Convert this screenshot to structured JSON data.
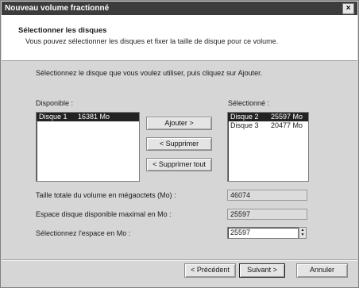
{
  "window": {
    "title": "Nouveau volume fractionné",
    "close_glyph": "×"
  },
  "header": {
    "title": "Sélectionner les disques",
    "subtitle": "Vous pouvez sélectionner les disques et fixer la taille de disque pour ce volume."
  },
  "instruction": "Sélectionnez le disque que vous voulez utiliser, puis cliquez sur Ajouter.",
  "available": {
    "label": "Disponible :",
    "items": [
      {
        "disk": "Disque 1",
        "size": "16381 Mo",
        "selected": true
      }
    ]
  },
  "selected": {
    "label": "Sélectionné :",
    "items": [
      {
        "disk": "Disque 2",
        "size": "25597 Mo",
        "selected": true
      },
      {
        "disk": "Disque 3",
        "size": "20477 Mo",
        "selected": false
      }
    ]
  },
  "buttons": {
    "add": "Ajouter >",
    "remove": "< Supprimer",
    "remove_all": "< Supprimer tout",
    "back": "< Précédent",
    "next": "Suivant >",
    "cancel": "Annuler"
  },
  "fields": {
    "total_label": "Taille totale du volume en mégaoctets (Mo) :",
    "total_value": "46074",
    "max_label": "Espace disque disponible maximal en Mo :",
    "max_value": "25597",
    "space_label": "Sélectionnez l'espace en Mo :",
    "space_value": "25597"
  },
  "colors": {
    "title_bar": "#3c3c3c",
    "selection": "#222222",
    "dialog_bg": "#d6d6d6"
  },
  "icons": {
    "close": "close-icon",
    "spin_up": "spin-up-icon",
    "spin_down": "spin-down-icon"
  }
}
